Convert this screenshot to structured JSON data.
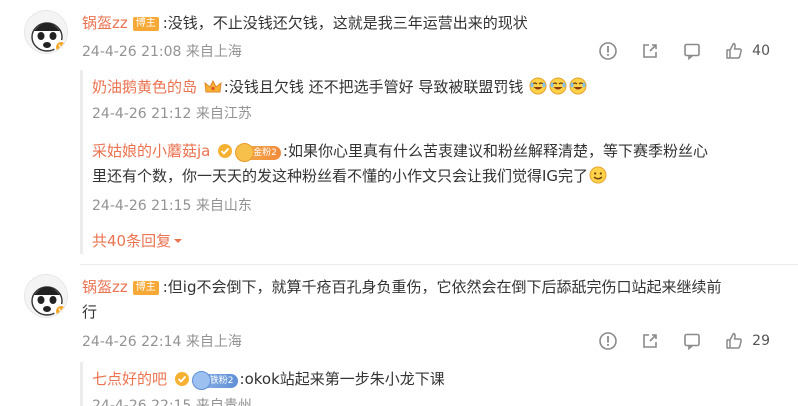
{
  "comments": [
    {
      "user": "锅盔zz",
      "badge": "博主",
      "text": ":没钱，不止没钱还欠钱，这就是我三年运营出来的现状",
      "time": "24-4-26 21:08 来自上海",
      "likes": "40",
      "replies": [
        {
          "user": "奶油鹅黄色的岛",
          "text": ":没钱且欠钱 还不把选手管好 导致被联盟罚钱",
          "time": "24-4-26 21:12 来自江苏"
        },
        {
          "user": "采姑娘的小蘑菇ja",
          "fan_badge": "金粉2",
          "text_line1": ":如果你心里真有什么苦衷建议和粉丝解释清楚，等下赛季粉丝心",
          "text_line2": "里还有个数，你一天天的发这种粉丝看不懂的小作文只会让我们觉得IG完了",
          "time": "24-4-26 21:15 来自山东"
        }
      ],
      "more_replies": "共40条回复"
    },
    {
      "user": "锅盔zz",
      "badge": "博主",
      "text_line1": ":但ig不会倒下，就算千疮百孔身负重伤，它依然会在倒下后舔舐完伤口站起来继续前",
      "text_line2": "行",
      "time": "24-4-26 22:14 来自上海",
      "likes": "29",
      "replies": [
        {
          "user": "七点好的吧",
          "fan_badge": "铁粉2",
          "text": ":okok站起来第一步朱小龙下课",
          "time": "24-4-26 22:15 来自贵州"
        }
      ]
    }
  ],
  "colors": {
    "username": "#eb7350",
    "meta": "#939393",
    "host_badge": "#f7a935"
  },
  "icons": [
    "report-icon",
    "share-icon",
    "comment-icon",
    "like-icon",
    "verified-icon",
    "crown-icon",
    "laughing-emoji",
    "smile-emoji",
    "caret-down-icon"
  ]
}
